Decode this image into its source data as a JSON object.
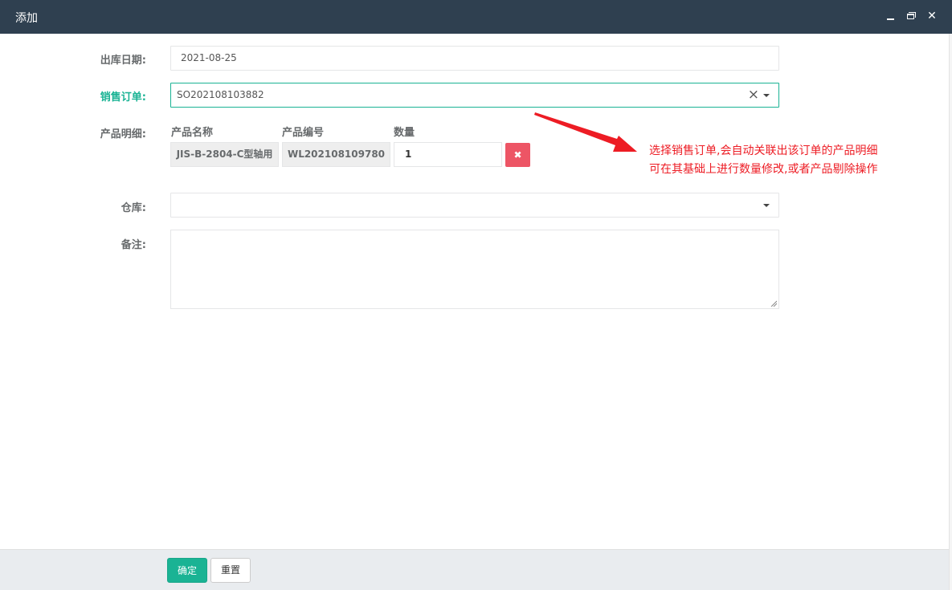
{
  "dialog": {
    "title": "添加",
    "minimize_icon": "minimize-icon",
    "maximize_icon": "restore-icon",
    "close_glyph": "✕"
  },
  "form": {
    "outbound_date": {
      "label": "出库日期:",
      "value": "2021-08-25"
    },
    "sales_order": {
      "label": "销售订单:",
      "value": "SO202108103882",
      "clear_glyph": "×"
    },
    "product_detail": {
      "label": "产品明细:",
      "columns": [
        "产品名称",
        "产品编号",
        "数量"
      ],
      "rows": [
        {
          "name": "JIS-B-2804-C型轴用",
          "code": "WL202108109780",
          "quantity": "1",
          "delete_glyph": "✖"
        }
      ]
    },
    "warehouse": {
      "label": "仓库:",
      "value": ""
    },
    "remark": {
      "label": "备注:",
      "value": ""
    }
  },
  "annotation": {
    "line1": "选择销售订单,会自动关联出该订单的产品明细",
    "line2": "可在其基础上进行数量修改,或者产品剔除操作",
    "color": "#ed1c24"
  },
  "footer": {
    "confirm_label": "确定",
    "reset_label": "重置"
  },
  "colors": {
    "titlebar": "#2f4050",
    "primary": "#1ab394",
    "danger": "#ed5565"
  }
}
